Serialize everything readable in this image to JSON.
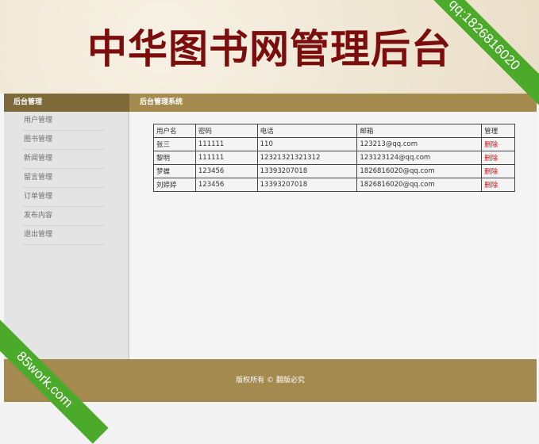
{
  "header": {
    "title": "中华图书网管理后台"
  },
  "watermarks": {
    "top_right": "qq:1826816020",
    "bottom_left": "85work.com"
  },
  "sidebar": {
    "title": "后台管理",
    "items": [
      {
        "label": "用户管理"
      },
      {
        "label": "图书管理"
      },
      {
        "label": "新闻管理"
      },
      {
        "label": "留言管理"
      },
      {
        "label": "订单管理"
      },
      {
        "label": "发布内容"
      },
      {
        "label": "退出管理"
      }
    ]
  },
  "main": {
    "title": "后台管理系统",
    "table": {
      "headers": [
        "用户名",
        "密码",
        "电话",
        "邮箱",
        "管理"
      ],
      "rows": [
        {
          "username": "张三",
          "password": "111111",
          "phone": "110",
          "email": "123213@qq.com",
          "action": "删除"
        },
        {
          "username": "黎明",
          "password": "111111",
          "phone": "12321321321312",
          "email": "123123124@qq.com",
          "action": "删除"
        },
        {
          "username": "梦蝶",
          "password": "123456",
          "phone": "13393207018",
          "email": "1826816020@qq.com",
          "action": "删除"
        },
        {
          "username": "刘婷婷",
          "password": "123456",
          "phone": "13393207018",
          "email": "1826816020@qq.com",
          "action": "删除"
        }
      ]
    }
  },
  "footer": {
    "text": "版权所有 © 翻版必究"
  },
  "colors": {
    "title": "#7b0d0d",
    "header_bar_dark": "#7e6939",
    "header_bar_light": "#a68b4f",
    "footer": "#a48a4f",
    "delete_link": "#dd1111",
    "watermark": "#4caa2a"
  }
}
